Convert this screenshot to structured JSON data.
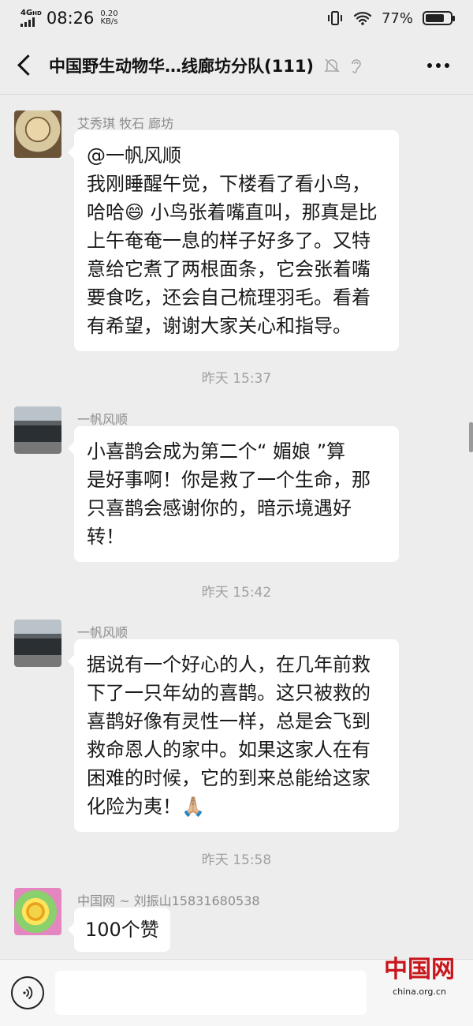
{
  "status_bar": {
    "network": "4G",
    "network_sub": "HD",
    "time": "08:26",
    "speed_value": "0.20",
    "speed_unit": "KB/s",
    "battery_percent": "77%",
    "battery_level": 0.77
  },
  "header": {
    "title": "中国野生动物华…线廊坊分队(111)"
  },
  "messages": [
    {
      "sender": "艾秀琪  牧石  廊坊",
      "lines": [
        "@一帆风顺",
        "我刚睡醒午觉，下楼看了看小鸟，",
        "哈哈😄 小鸟张着嘴直叫，那真是比",
        "上午奄奄一息的样子好多了。又特",
        "意给它煮了两根面条，它会张着嘴",
        "要食吃，还会自己梳理羽毛。看着",
        "有希望，谢谢大家关心和指导。"
      ]
    },
    {
      "timestamp": "昨天 15:37"
    },
    {
      "sender": "一帆风顺",
      "lines": [
        "小喜鹊会成为第二个“ 媚娘 ”算",
        "是好事啊！你是救了一个生命，那",
        "只喜鹊会感谢你的，暗示境遇好",
        "转！"
      ]
    },
    {
      "timestamp": "昨天 15:42"
    },
    {
      "sender": "一帆风顺",
      "lines": [
        "据说有一个好心的人，在几年前救",
        "下了一只年幼的喜鹊。这只被救的",
        "喜鹊好像有灵性一样，总是会飞到",
        "救命恩人的家中。如果这家人在有",
        "困难的时候，它的到来总能给这家",
        "化险为夷！🙏🏼"
      ]
    },
    {
      "timestamp": "昨天 15:58"
    },
    {
      "sender": "中国网 ~ 刘振山15831680538",
      "lines": [
        "100个赞"
      ]
    }
  ],
  "watermark": {
    "logo": "中国网",
    "url": "china.org.cn"
  },
  "icons": {
    "back": "back-arrow-icon",
    "mute": "bell-off-icon",
    "ear": "ear-icon",
    "more": "more-icon",
    "voice": "voice-icon"
  },
  "colors": {
    "background": "#ededed",
    "bubble": "#ffffff",
    "watermark_red": "#c8161d"
  }
}
